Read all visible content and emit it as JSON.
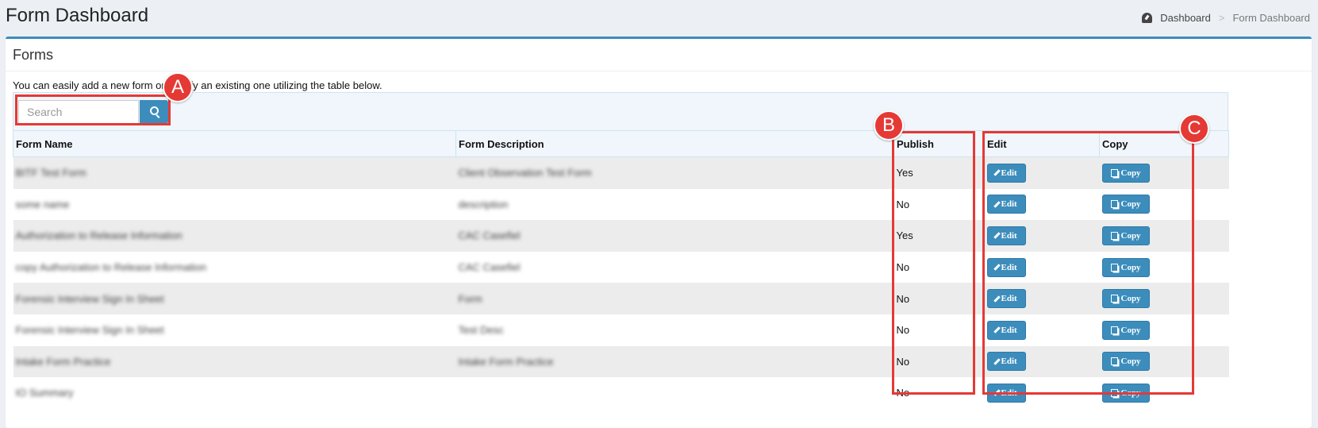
{
  "header": {
    "title": "Form Dashboard"
  },
  "breadcrumb": {
    "home_icon": "dashboard-icon",
    "home": "Dashboard",
    "separator": ">",
    "current": "Form Dashboard"
  },
  "panel": {
    "title": "Forms",
    "intro": "You can easily add a new form or modify an existing one utilizing the table below."
  },
  "search": {
    "placeholder": "Search",
    "button_icon": "search-icon"
  },
  "table": {
    "columns": [
      "Form Name",
      "Form Description",
      "Publish",
      "Edit",
      "Copy"
    ],
    "edit_label": "Edit",
    "copy_label": "Copy",
    "rows": [
      {
        "name": "BITF Test Form",
        "description": "Client Observation Test Form",
        "publish": "Yes"
      },
      {
        "name": "some name",
        "description": "description",
        "publish": "No"
      },
      {
        "name": "Authorization to Release Information",
        "description": "CAC Casefiel",
        "publish": "Yes"
      },
      {
        "name": "copy Authorization to Release Information",
        "description": "CAC Casefiel",
        "publish": "No"
      },
      {
        "name": "Forensic Interview Sign In Sheet",
        "description": "Form",
        "publish": "No"
      },
      {
        "name": "Forensic Interview Sign In Sheet",
        "description": "Test Desc",
        "publish": "No"
      },
      {
        "name": "Intake Form Practice",
        "description": "Intake Form Practice",
        "publish": "No"
      },
      {
        "name": "IO Summary",
        "description": "",
        "publish": "No"
      }
    ]
  },
  "annotations": {
    "a": "A",
    "b": "B",
    "c": "C",
    "color": "#e53935"
  },
  "colors": {
    "accent": "#3c8dbc",
    "annotation": "#e53935"
  }
}
